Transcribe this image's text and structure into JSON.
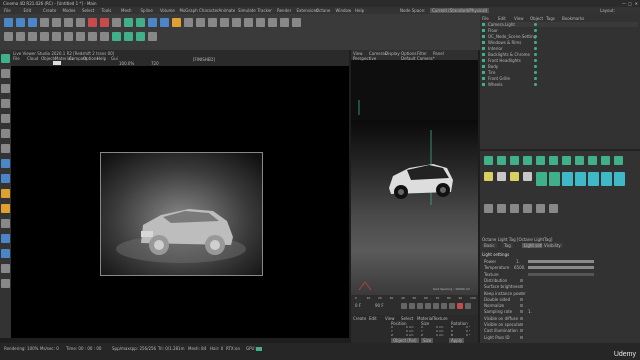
{
  "window": {
    "title": "Cinema 4D R21.026 (RC) - [Untitled 1 *] - Main"
  },
  "menu": {
    "items": [
      "File",
      "Edit",
      "Create",
      "Modes",
      "Select",
      "Tools",
      "Mesh",
      "Spline",
      "Volume",
      "MoGraph",
      "Character",
      "Animate",
      "Simulate",
      "Tracker",
      "Render",
      "Extensions",
      "Octane",
      "Window",
      "Help"
    ],
    "layout_label": "Node Space:",
    "layout_value": "Current (Standard/Physical)",
    "layout_right": "Layout:"
  },
  "ipr": {
    "title": "Live Viewer Studio 2020.1 R2 [Redshift 2 trans 00]",
    "menu": [
      "File",
      "Cloud",
      "Objects",
      "Materials",
      "Compare",
      "Options",
      "Help",
      "Gui"
    ],
    "zoom": "100.0%",
    "frame": "720",
    "status_label": "[FINISHED]"
  },
  "viewport": {
    "label": "Perspective",
    "camera": "Default Camera*",
    "menu": [
      "View",
      "Cameras",
      "Display",
      "Options",
      "Filter",
      "Panel"
    ],
    "grid_spacing": "Grid Spacing : 10000 cm"
  },
  "timeline": {
    "ticks": [
      "0",
      "10",
      "20",
      "30",
      "40",
      "50",
      "60",
      "70",
      "80",
      "90",
      "100"
    ],
    "frame_start": "0 F",
    "frame_end": "90 F"
  },
  "matmgr": {
    "menu": [
      "Create",
      "Edit",
      "View",
      "Select",
      "Material",
      "Texture"
    ],
    "coords_headers": [
      "Position",
      "Size",
      "Rotation"
    ],
    "rows": [
      [
        "X",
        "0 cm",
        "X",
        "0 cm",
        "H",
        "0 °"
      ],
      [
        "Y",
        "0 cm",
        "Y",
        "0 cm",
        "P",
        "0 °"
      ],
      [
        "Z",
        "0 cm",
        "Z",
        "0 cm",
        "B",
        "0 °"
      ]
    ],
    "apply_button": "Apply",
    "object_select": "Object (Rel)",
    "size_select": "Size"
  },
  "objects": {
    "menu": [
      "File",
      "Edit",
      "View",
      "Object",
      "Tags",
      "Bookmarks"
    ],
    "items": [
      "Camera.Light",
      "Floor",
      "OC_Node_Scene.Setting",
      "Windows & Rims",
      "Interior",
      "Backlights & Chrome",
      "Front Headlights",
      "Body",
      "Tire",
      "Front Grille",
      "Wheels"
    ]
  },
  "attributes": {
    "title": "Octane Light Tag [Octane LightTag]",
    "tabs": [
      "Basic",
      "Tag",
      "Light settings",
      "Visibility"
    ],
    "section": "Light settings",
    "fields": [
      "Power",
      "Temperature",
      "Texture",
      "Distribution",
      "Surface brightness",
      "Keep instance power",
      "Double sided",
      "Normalize",
      "Sampling rate",
      "Visible on diffuse",
      "Visible on specular",
      "Cast illumination",
      "Light Pass ID"
    ],
    "power_value": "1.",
    "temperature_value": "6500.",
    "sampling_value": "1."
  },
  "status": {
    "rendering": "Rendering: 100%",
    "ms": "Ms/sec: 0",
    "time": "Time: 00 : 00 : 00",
    "spp": "Spp/maxspp: 256/256",
    "tri": "Tri: 0/1.281m",
    "mesh": "Mesh: 84",
    "hair": "Hair: 0",
    "rtx": "RTX:on",
    "gpu": "GPU:"
  },
  "watermark": "Udemy"
}
